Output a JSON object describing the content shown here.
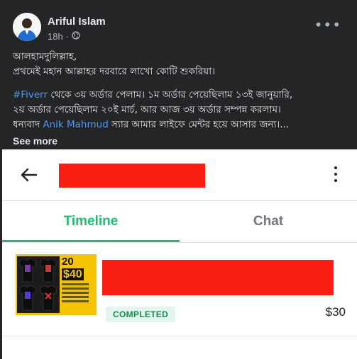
{
  "post": {
    "author": "Ariful Islam",
    "time": "18h",
    "more_icon": "more-horizontal-icon",
    "privacy_icon": "globe-icon",
    "lines": [
      "আলহামদুলিল্লাহ,",
      "প্রথমেই মহান আল্লাহর দরবারে লাখো কোটি শুকরিয়া।"
    ],
    "hashtag": "#Fiverr",
    "line3_rest": " থেকে ৩য় অর্ডার পেলাম। ১ম  অর্ডার পেয়েছিলাম ১৩ই জানুয়ারি,",
    "line4": "২য় অর্ডার পেয়েছিলাম ২০ই মার্চ, আর আজ ৩য় অর্ডার সম্পন্ন করলাম।",
    "line5_pre": "ধন্যবাদ ",
    "mention": "Anik Mahmud",
    "line5_post": " স্যার আমার লাইফে মেন্টর হয়ে আসার জন্য।...",
    "see_more": "See more"
  },
  "screenshot": {
    "tabs": [
      {
        "label": "Timeline",
        "active": true
      },
      {
        "label": "Chat",
        "active": false
      }
    ],
    "order": {
      "thumb_count": "20",
      "thumb_price": "$40",
      "status": "COMPLETED",
      "price": "$30"
    },
    "colors": {
      "accent": "#1dbf73",
      "redaction": "#fb1e12",
      "badge_bg": "#e3f6ec"
    }
  }
}
